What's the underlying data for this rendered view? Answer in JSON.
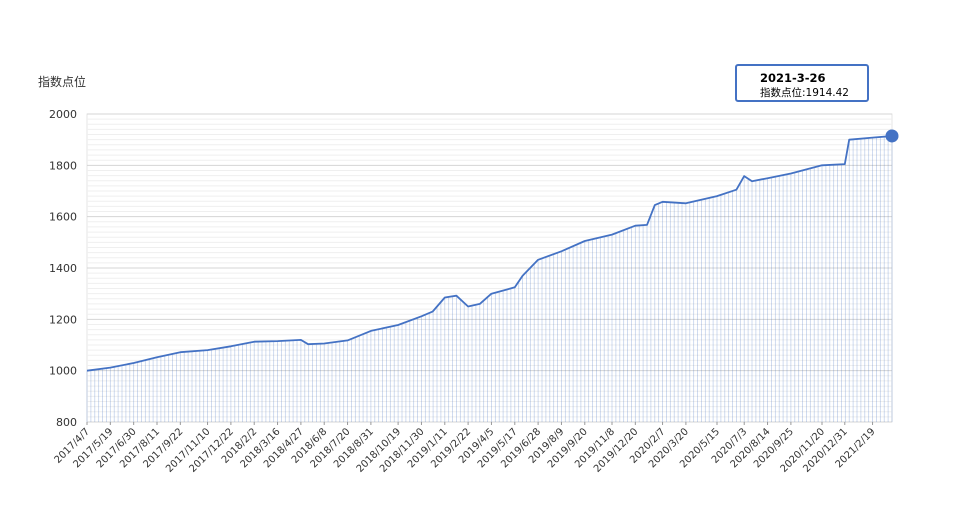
{
  "chart_data": {
    "type": "area",
    "ylabel": "指数点位",
    "ylim": [
      800,
      2000
    ],
    "yticks": [
      800,
      1000,
      1200,
      1400,
      1600,
      1800,
      2000
    ],
    "x_tick_labels": [
      "2017/4/7",
      "2017/5/19",
      "2017/6/30",
      "2017/8/11",
      "2017/9/22",
      "2017/11/10",
      "2017/12/22",
      "2018/2/2",
      "2018/3/16",
      "2018/4/27",
      "2018/6/8",
      "2018/7/20",
      "2018/8/31",
      "2018/10/19",
      "2018/11/30",
      "2019/1/11",
      "2019/2/22",
      "2019/4/5",
      "2019/5/17",
      "2019/6/28",
      "2019/8/9",
      "2019/9/20",
      "2019/11/8",
      "2019/12/20",
      "2020/2/7",
      "2020/3/20",
      "2020/5/15",
      "2020/7/3",
      "2020/8/14",
      "2020/9/25",
      "2020/11/20",
      "2020/12/31",
      "2021/2/19"
    ],
    "grid": true,
    "series": [
      {
        "color": "#4472c4",
        "points": [
          {
            "x": "2017/4/7",
            "y": 1000
          },
          {
            "x": "2017/5/19",
            "y": 1012
          },
          {
            "x": "2017/6/30",
            "y": 1030
          },
          {
            "x": "2017/8/11",
            "y": 1052
          },
          {
            "x": "2017/9/22",
            "y": 1072
          },
          {
            "x": "2017/11/10",
            "y": 1080
          },
          {
            "x": "2017/12/22",
            "y": 1095
          },
          {
            "x": "2018/2/2",
            "y": 1113
          },
          {
            "x": "2018/3/16",
            "y": 1115
          },
          {
            "x": "2018/4/27",
            "y": 1120
          },
          {
            "x": "2018/5/10",
            "y": 1103
          },
          {
            "x": "2018/6/8",
            "y": 1106
          },
          {
            "x": "2018/7/20",
            "y": 1118
          },
          {
            "x": "2018/8/31",
            "y": 1155
          },
          {
            "x": "2018/10/19",
            "y": 1178
          },
          {
            "x": "2018/11/30",
            "y": 1212
          },
          {
            "x": "2018/12/20",
            "y": 1230
          },
          {
            "x": "2019/1/11",
            "y": 1285
          },
          {
            "x": "2019/2/1",
            "y": 1292
          },
          {
            "x": "2019/2/22",
            "y": 1250
          },
          {
            "x": "2019/3/15",
            "y": 1260
          },
          {
            "x": "2019/4/5",
            "y": 1300
          },
          {
            "x": "2019/5/17",
            "y": 1325
          },
          {
            "x": "2019/5/31",
            "y": 1370
          },
          {
            "x": "2019/6/28",
            "y": 1432
          },
          {
            "x": "2019/8/9",
            "y": 1465
          },
          {
            "x": "2019/9/20",
            "y": 1505
          },
          {
            "x": "2019/11/8",
            "y": 1530
          },
          {
            "x": "2019/12/20",
            "y": 1565
          },
          {
            "x": "2020/1/10",
            "y": 1568
          },
          {
            "x": "2020/1/24",
            "y": 1645
          },
          {
            "x": "2020/2/7",
            "y": 1658
          },
          {
            "x": "2020/3/20",
            "y": 1652
          },
          {
            "x": "2020/5/15",
            "y": 1680
          },
          {
            "x": "2020/6/19",
            "y": 1705
          },
          {
            "x": "2020/7/3",
            "y": 1758
          },
          {
            "x": "2020/7/17",
            "y": 1738
          },
          {
            "x": "2020/8/14",
            "y": 1750
          },
          {
            "x": "2020/9/25",
            "y": 1768
          },
          {
            "x": "2020/11/20",
            "y": 1800
          },
          {
            "x": "2020/12/31",
            "y": 1805
          },
          {
            "x": "2021/1/8",
            "y": 1900
          },
          {
            "x": "2021/2/19",
            "y": 1908
          },
          {
            "x": "2021/3/26",
            "y": 1914.42
          }
        ]
      }
    ],
    "tooltip": {
      "date": "2021-3-26",
      "label": "指数点位",
      "value": "1914.42",
      "text": "指数点位:1914.42"
    }
  }
}
